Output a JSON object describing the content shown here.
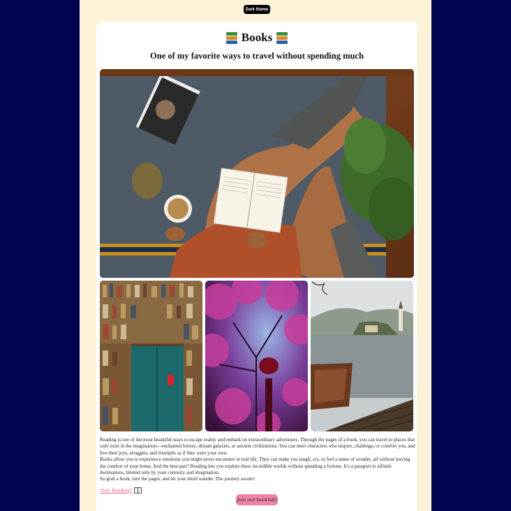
{
  "header": {
    "theme_toggle_label": "Dark theme"
  },
  "card": {
    "title": "Books",
    "subtitle": "One of my favorite ways to travel without spending much"
  },
  "gallery": {
    "hero_icon": "reading-flatlay-photo",
    "thumbs": [
      "bookshelf-door-photo",
      "pink-tree-lamp-photo",
      "lake-castle-boat-photo"
    ]
  },
  "text": {
    "p1": "Reading is one of the most beautiful ways to escape reality and embark on extraordinary adventures. Through the pages of a book, you can travel to places that only exist in the imagination—enchanted forests, distant galaxies, or ancient civilizations. You can meet characters who inspire, challenge, or comfort you, and live their joys, struggles, and triumphs as if they were your own.",
    "p2": "Books allow you to experience emotions you might never encounter in real life. They can make you laugh, cry, or feel a sense of wonder, all without leaving the comfort of your home. And the best part? Reading lets you explore these incredible worlds without spending a fortune. It's a passport to infinite destinations, limited only by your curiosity and imagination.",
    "p3": "So grab a book, turn the pages, and let your mind wander. The journey awaits!"
  },
  "actions": {
    "start_label": "Start Reading!",
    "join_label": "Join our booklub!"
  },
  "colors": {
    "page_bg": "#02044f",
    "panel_bg": "#fdf3d9",
    "accent_pink": "#ec84a6",
    "link_pink": "#e46b9d"
  }
}
